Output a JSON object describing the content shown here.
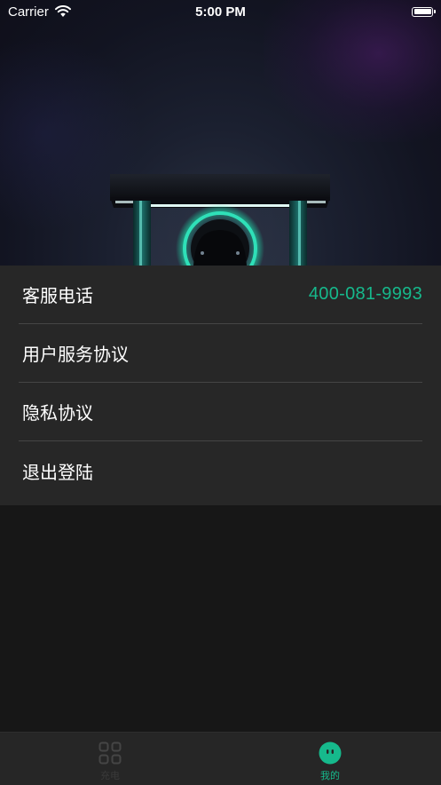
{
  "status_bar": {
    "carrier": "Carrier",
    "time": "5:00 PM"
  },
  "menu": {
    "items": [
      {
        "label": "客服电话",
        "value": "400-081-9993"
      },
      {
        "label": "用户服务协议"
      },
      {
        "label": "隐私协议"
      },
      {
        "label": "退出登陆"
      }
    ]
  },
  "tabbar": {
    "tabs": [
      {
        "label": "充电",
        "icon": "grid-icon",
        "active": false
      },
      {
        "label": "我的",
        "icon": "smiley-face-icon",
        "active": true
      }
    ]
  },
  "colors": {
    "accent": "#16b98c",
    "background": "#171717",
    "menu_background": "#272727",
    "divider": "#454545"
  }
}
